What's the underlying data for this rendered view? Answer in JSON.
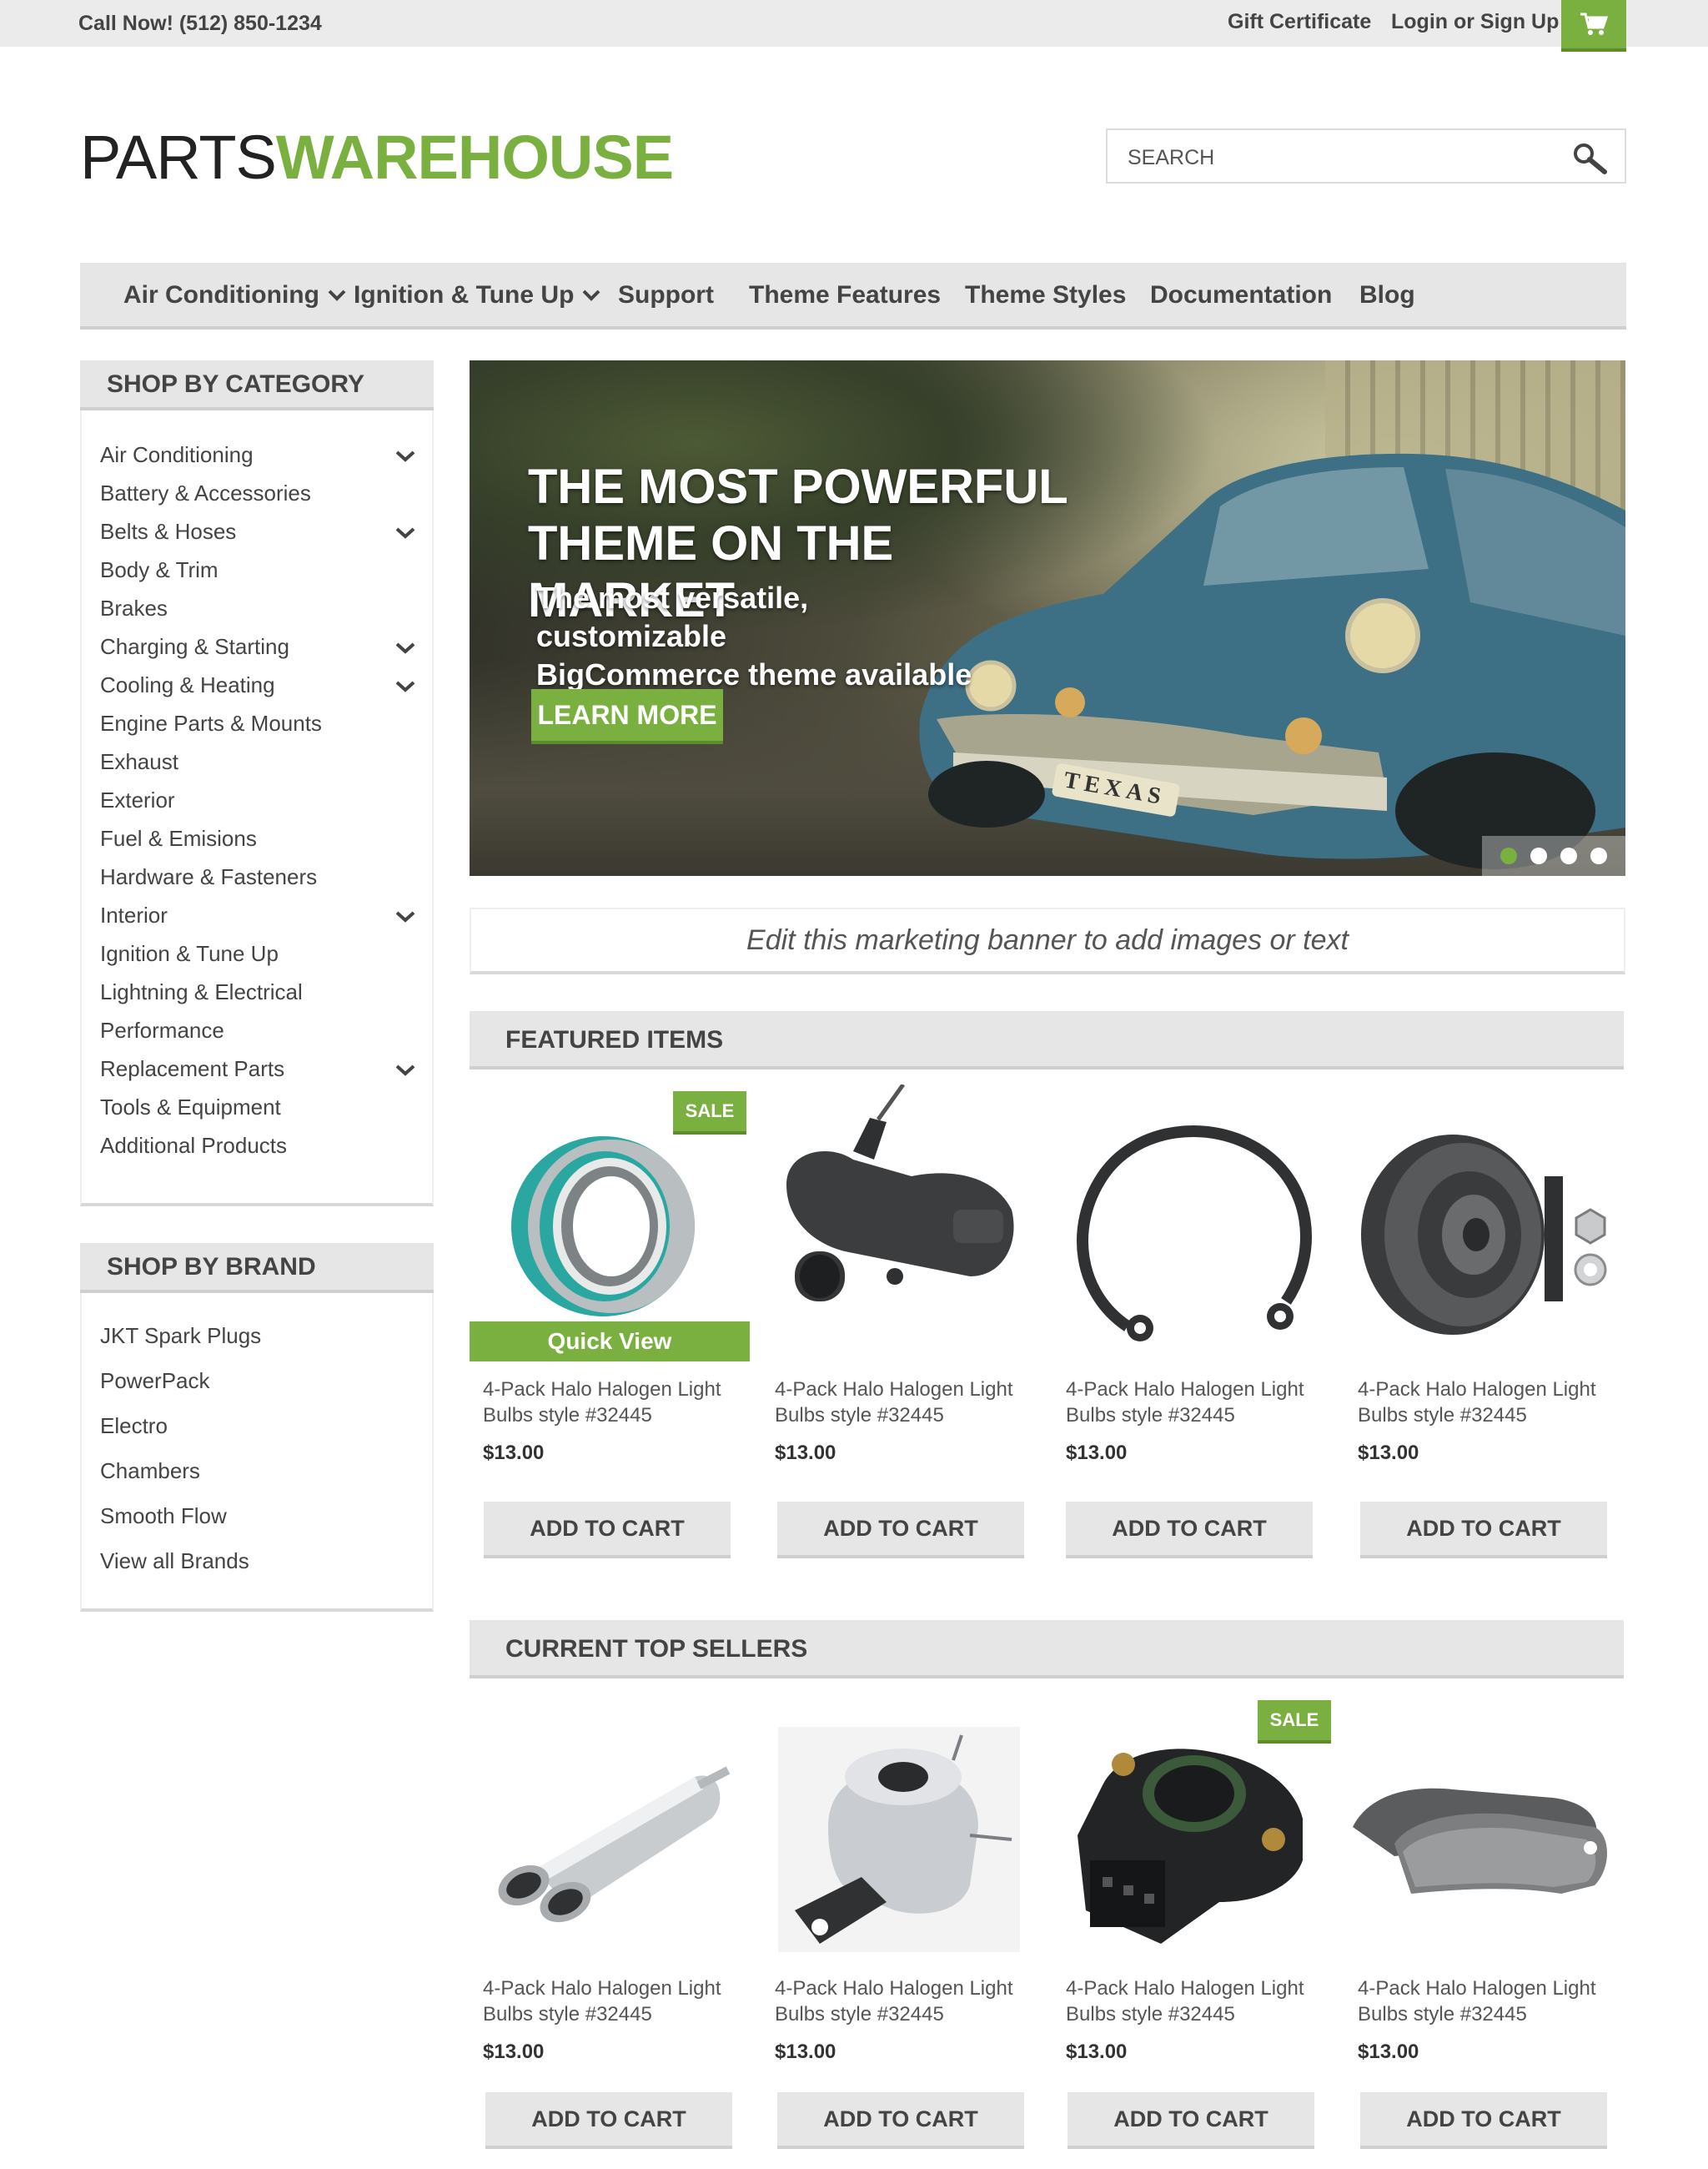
{
  "topbar": {
    "phone": "Call Now! (512) 850-1234",
    "gift": "Gift Certificate",
    "login": "Login or Sign Up",
    "cart_icon": "shopping-cart-icon"
  },
  "logo": {
    "part1": "PARTS",
    "part2": "WAREHOUSE"
  },
  "search": {
    "placeholder": "SEARCH",
    "icon": "search-icon"
  },
  "nav": {
    "items": [
      {
        "label": "Air Conditioning",
        "dropdown": true
      },
      {
        "label": "Ignition & Tune Up",
        "dropdown": true
      },
      {
        "label": "Support"
      },
      {
        "label": "Theme Features"
      },
      {
        "label": "Theme Styles"
      },
      {
        "label": "Documentation"
      },
      {
        "label": "Blog"
      }
    ]
  },
  "sidebar": {
    "category_title": "SHOP BY CATEGORY",
    "categories": [
      {
        "label": "Air Conditioning",
        "expand": true
      },
      {
        "label": "Battery & Accessories"
      },
      {
        "label": "Belts & Hoses",
        "expand": true
      },
      {
        "label": "Body & Trim"
      },
      {
        "label": "Brakes"
      },
      {
        "label": "Charging & Starting",
        "expand": true
      },
      {
        "label": "Cooling & Heating",
        "expand": true
      },
      {
        "label": "Engine Parts & Mounts"
      },
      {
        "label": "Exhaust"
      },
      {
        "label": "Exterior"
      },
      {
        "label": "Fuel & Emisions"
      },
      {
        "label": "Hardware & Fasteners"
      },
      {
        "label": "Interior",
        "expand": true
      },
      {
        "label": "Ignition & Tune Up"
      },
      {
        "label": "Lightning & Electrical"
      },
      {
        "label": "Performance"
      },
      {
        "label": "Replacement Parts",
        "expand": true
      },
      {
        "label": "Tools & Equipment"
      },
      {
        "label": "Additional Products"
      }
    ],
    "brand_title": "SHOP BY BRAND",
    "brands": [
      "JKT Spark Plugs",
      "PowerPack",
      "Electro",
      "Chambers",
      "Smooth Flow",
      "View all Brands"
    ]
  },
  "hero": {
    "title_line1": "THE MOST POWERFUL",
    "title_line2": "THEME ON THE MARKET",
    "sub_line1": "The most versatile, customizable",
    "sub_line2": "BigCommerce theme available",
    "button": "LEARN MORE",
    "plate": "TEXAS",
    "slides": 4,
    "active_slide": 1
  },
  "banner": {
    "text": "Edit this marketing banner to add images or text"
  },
  "featured": {
    "title": "FEATURED ITEMS",
    "sale_label": "SALE",
    "quick_view": "Quick View",
    "products": [
      {
        "name": "4-Pack Halo Halogen Light Bulbs style #32445",
        "price": "$13.00",
        "button": "ADD TO CART",
        "sale": true,
        "image": "bearing"
      },
      {
        "name": "4-Pack Halo Halogen Light Bulbs style #32445",
        "price": "$13.00",
        "button": "ADD TO CART",
        "image": "intake-hose"
      },
      {
        "name": "4-Pack Halo Halogen Light Bulbs style #32445",
        "price": "$13.00",
        "button": "ADD TO CART",
        "image": "snap-ring"
      },
      {
        "name": "4-Pack Halo Halogen Light Bulbs style #32445",
        "price": "$13.00",
        "button": "ADD TO CART",
        "image": "tensioner-pulley"
      }
    ]
  },
  "top_sellers": {
    "title": "CURRENT TOP SELLERS",
    "sale_label": "SALE",
    "products": [
      {
        "name": "4-Pack Halo Halogen Light Bulbs style #32445",
        "price": "$13.00",
        "button": "ADD TO CART",
        "image": "exhaust-muffler"
      },
      {
        "name": "4-Pack Halo Halogen Light Bulbs style #32445",
        "price": "$13.00",
        "button": "ADD TO CART",
        "image": "egr-valve"
      },
      {
        "name": "4-Pack Halo Halogen Light Bulbs style #32445",
        "price": "$13.00",
        "button": "ADD TO CART",
        "sale": true,
        "image": "throttle-sensor"
      },
      {
        "name": "4-Pack Halo Halogen Light Bulbs style #32445",
        "price": "$13.00",
        "button": "ADD TO CART",
        "image": "brake-pads"
      }
    ]
  },
  "colors": {
    "accent": "#7ab03f",
    "accent_dark": "#5e8c2a",
    "bar": "#e6e6e6",
    "text": "#444444"
  }
}
